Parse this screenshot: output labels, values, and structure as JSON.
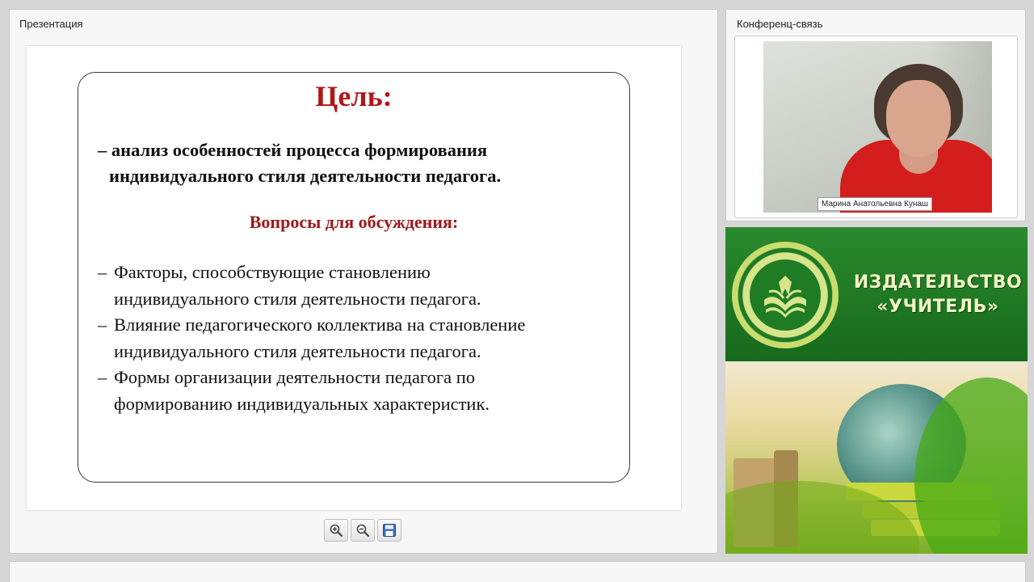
{
  "presentation": {
    "title": "Презентация",
    "slide": {
      "heading": "Цель:",
      "goal_line1": "– анализ особенностей процесса формирования",
      "goal_line2": "индивидуального стиля  деятельности педагога.",
      "subheading": "Вопросы для обсуждения:",
      "questions": [
        {
          "line1": "Факторы, способствующие становлению",
          "line2": "индивидуального стиля деятельности педагога."
        },
        {
          "line1": "Влияние педагогического коллектива на становление",
          "line2": "индивидуального стиля деятельности педагога."
        },
        {
          "line1": "Формы организации деятельности педагога по",
          "line2": "формированию индивидуальных характеристик."
        }
      ],
      "dash": "–"
    },
    "toolbar": {
      "zoom_in_icon": "zoom-in-icon",
      "zoom_out_icon": "zoom-out-icon",
      "save_icon": "floppy-disk-icon"
    }
  },
  "conference": {
    "title": "Конференц-связь",
    "participant_name": "Марина Анатольевна Кунаш"
  },
  "publisher_banner": {
    "line1": "ИЗДАТЕЛЬСТВО",
    "line2": "«УЧИТЕЛЬ»",
    "colors": {
      "primary": "#1f7c24",
      "accent": "#d6e58c"
    }
  }
}
